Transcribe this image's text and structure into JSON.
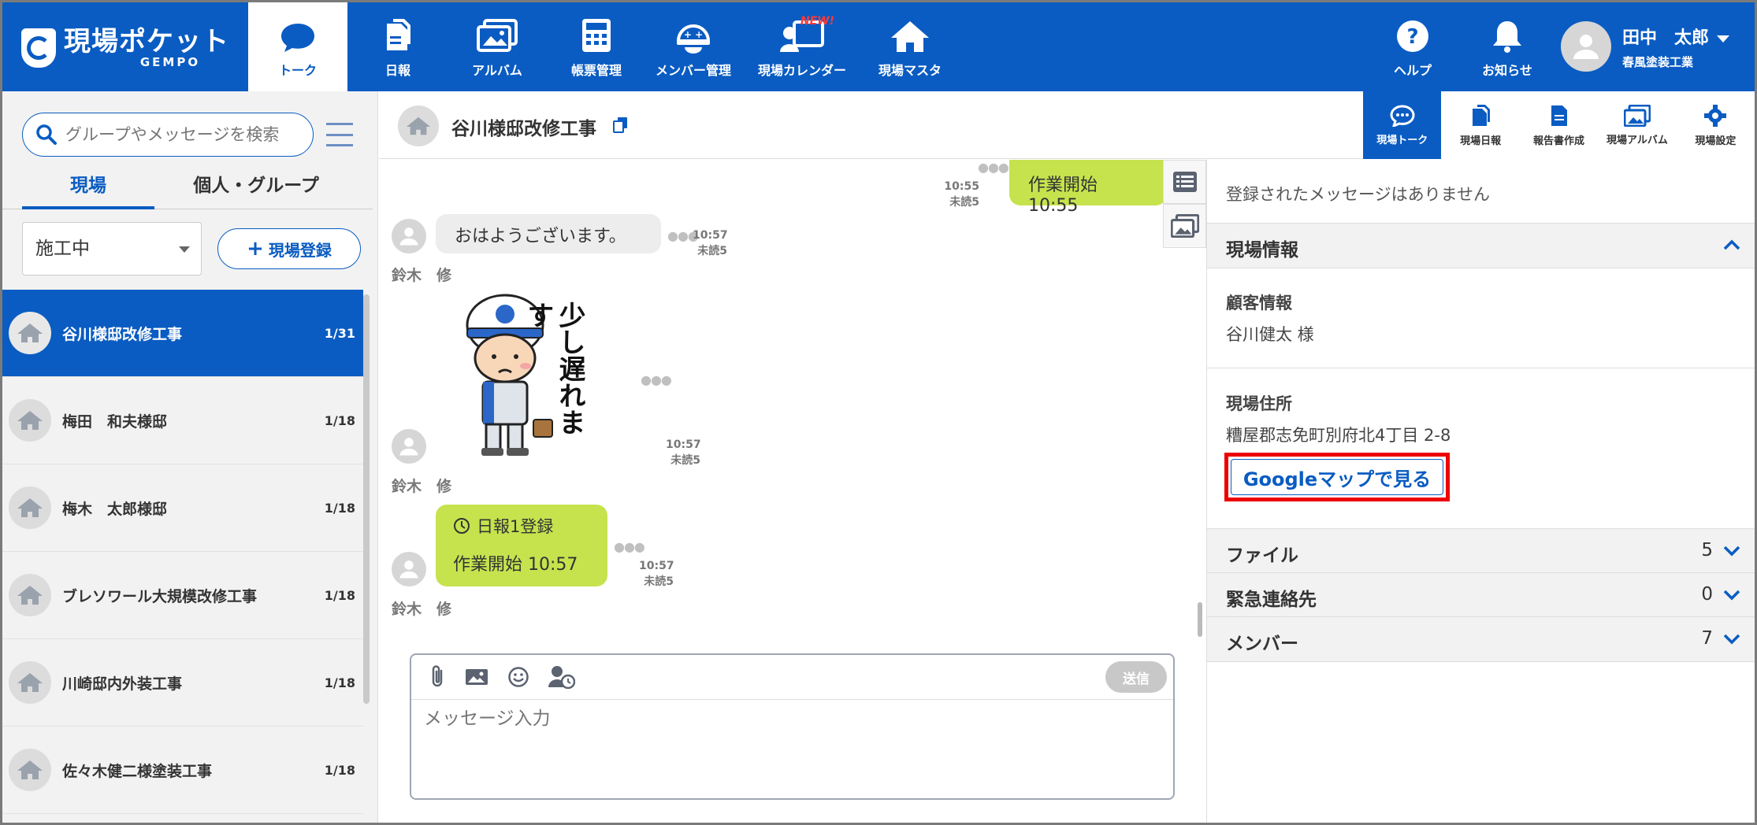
{
  "brand": {
    "title": "現場ポケット",
    "subtitle": "GEMPO"
  },
  "nav": [
    {
      "label": "トーク",
      "icon": "chat-bubble-icon",
      "active": true
    },
    {
      "label": "日報",
      "icon": "document-copy-icon"
    },
    {
      "label": "アルバム",
      "icon": "album-icon"
    },
    {
      "label": "帳票管理",
      "icon": "calculator-icon"
    },
    {
      "label": "メンバー管理",
      "icon": "helmet-icon"
    },
    {
      "label": "現場カレンダー",
      "icon": "calendar-person-icon",
      "badge": "NEW!"
    },
    {
      "label": "現場マスタ",
      "icon": "house-icon"
    }
  ],
  "header_right": {
    "help": "ヘルプ",
    "notice": "お知らせ",
    "user_name": "田中　太郎",
    "user_company": "春風塗装工業"
  },
  "sidebar": {
    "search_placeholder": "グループやメッセージを検索",
    "tabs": [
      "現場",
      "個人・グループ"
    ],
    "status_select": "施工中",
    "add_site": "現場登録",
    "sites": [
      {
        "name": "谷川様邸改修工事",
        "count": "1/31"
      },
      {
        "name": "梅田　和夫様邸",
        "count": "1/18"
      },
      {
        "name": "梅木　太郎様邸",
        "count": "1/18"
      },
      {
        "name": "ブレソワール大規模改修工事",
        "count": "1/18"
      },
      {
        "name": "川崎邸内外装工事",
        "count": "1/18"
      },
      {
        "name": "佐々木健二様塗装工事",
        "count": "1/18"
      }
    ]
  },
  "chat": {
    "title": "谷川様邸改修工事",
    "messages": {
      "m1": {
        "text": "作業開始  10:55",
        "time": "10:55",
        "unread": "未読5"
      },
      "m2": {
        "text": "おはようございます。",
        "time": "10:57",
        "unread": "未読5",
        "sender": "鈴木　修"
      },
      "m3": {
        "sticker_text": "少し遅れます",
        "time": "10:57",
        "unread": "未読5",
        "sender": "鈴木　修"
      },
      "m4": {
        "title": "日報1登録",
        "text": "作業開始  10:57",
        "time": "10:57",
        "unread": "未読5",
        "sender": "鈴木　修"
      }
    },
    "compose_placeholder": "メッセージ入力",
    "send_label": "送信"
  },
  "right_tabs": [
    {
      "label": "現場トーク",
      "active": true
    },
    {
      "label": "現場日報"
    },
    {
      "label": "報告書作成"
    },
    {
      "label": "現場アルバム"
    },
    {
      "label": "現場設定"
    }
  ],
  "right_panel": {
    "no_messages": "登録されたメッセージはありません",
    "site_info_header": "現場情報",
    "customer_label": "顧客情報",
    "customer_value": "谷川健太 様",
    "address_label": "現場住所",
    "address_value": "糟屋郡志免町別府北4丁目 2-8",
    "map_button": "Googleマップで見る",
    "files_label": "ファイル",
    "files_count": "5",
    "emergency_label": "緊急連絡先",
    "emergency_count": "0",
    "members_label": "メンバー",
    "members_count": "7"
  },
  "colors": {
    "primary": "#0a5cc2",
    "bubble_out": "#c6e34e",
    "highlight": "#ee0000"
  }
}
